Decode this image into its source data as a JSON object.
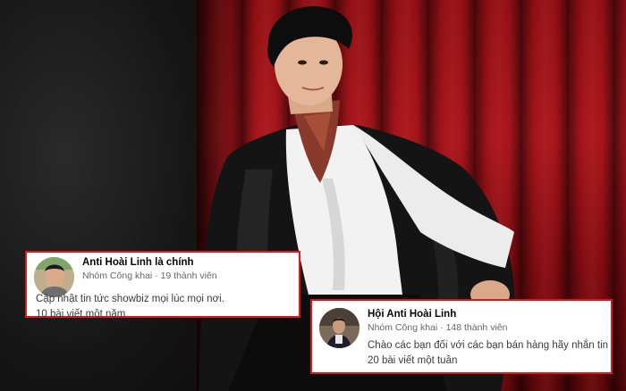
{
  "cards": [
    {
      "group_name": "Anti Hoài Linh là chính",
      "privacy": "Nhóm Công khai",
      "separator": "·",
      "members": "19 thành viên",
      "description": "Cập nhật tin tức showbiz mọi lúc mọi nơi.",
      "posts": "10 bài viết một năm"
    },
    {
      "group_name": "Hội Anti Hoài Linh",
      "privacy": "Nhóm Công khai",
      "separator": "·",
      "members": "148 thành viên",
      "description": "Chào các bạn đối với các bạn bán hàng hãy nhắn tin",
      "posts": "20 bài viết một tuần"
    }
  ],
  "colors": {
    "card_border": "#e0161b",
    "curtain": "#a5151b",
    "name_text": "#050505",
    "meta_text": "#65676b"
  }
}
